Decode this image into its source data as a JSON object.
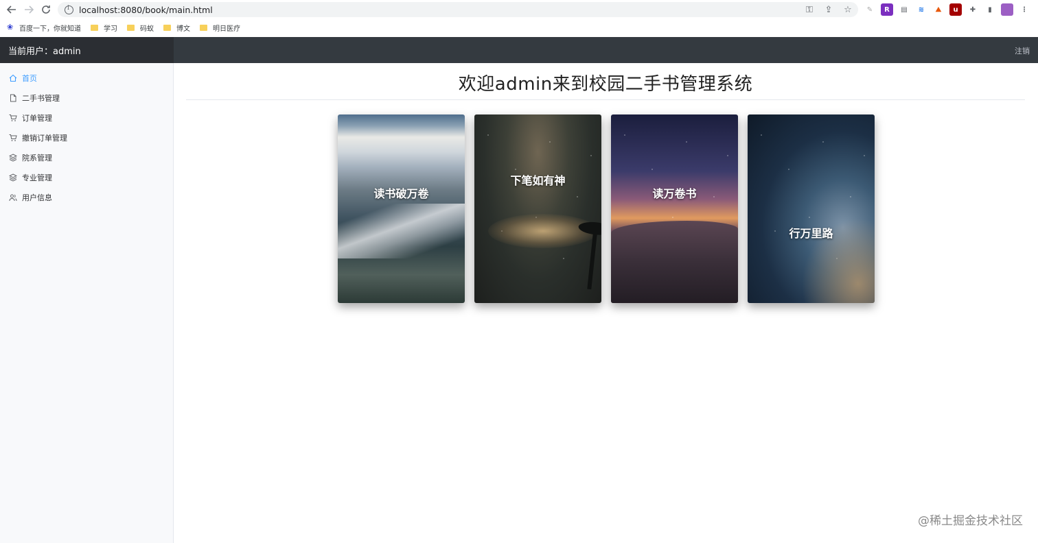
{
  "browser": {
    "url": "localhost:8080/book/main.html",
    "bookmarks": [
      {
        "label": "百度一下，你就知道",
        "icon": "baidu-paw-icon"
      },
      {
        "label": "学习",
        "icon": "folder-icon"
      },
      {
        "label": "码蚁",
        "icon": "folder-icon"
      },
      {
        "label": "博文",
        "icon": "folder-icon"
      },
      {
        "label": "明日医疗",
        "icon": "folder-icon"
      }
    ]
  },
  "header": {
    "current_user": "当前用户：admin",
    "logout_label": "注销"
  },
  "sidebar": {
    "items": [
      {
        "label": "首页",
        "icon": "home-icon",
        "active": true
      },
      {
        "label": "二手书管理",
        "icon": "document-icon"
      },
      {
        "label": "订单管理",
        "icon": "cart-icon"
      },
      {
        "label": "撤销订单管理",
        "icon": "cart-icon"
      },
      {
        "label": "院系管理",
        "icon": "layers-icon"
      },
      {
        "label": "专业管理",
        "icon": "layers-icon"
      },
      {
        "label": "用户信息",
        "icon": "users-icon"
      }
    ]
  },
  "main": {
    "welcome": "欢迎admin来到校园二手书管理系统",
    "cards": [
      {
        "title": "读书破万卷"
      },
      {
        "title": "下笔如有神"
      },
      {
        "title": "读万卷书"
      },
      {
        "title": "行万里路"
      }
    ]
  },
  "watermark": "@稀土掘金技术社区",
  "colors": {
    "accent": "#409eff",
    "header_dark": "#343a40",
    "brand_dark": "#2b2e33"
  }
}
